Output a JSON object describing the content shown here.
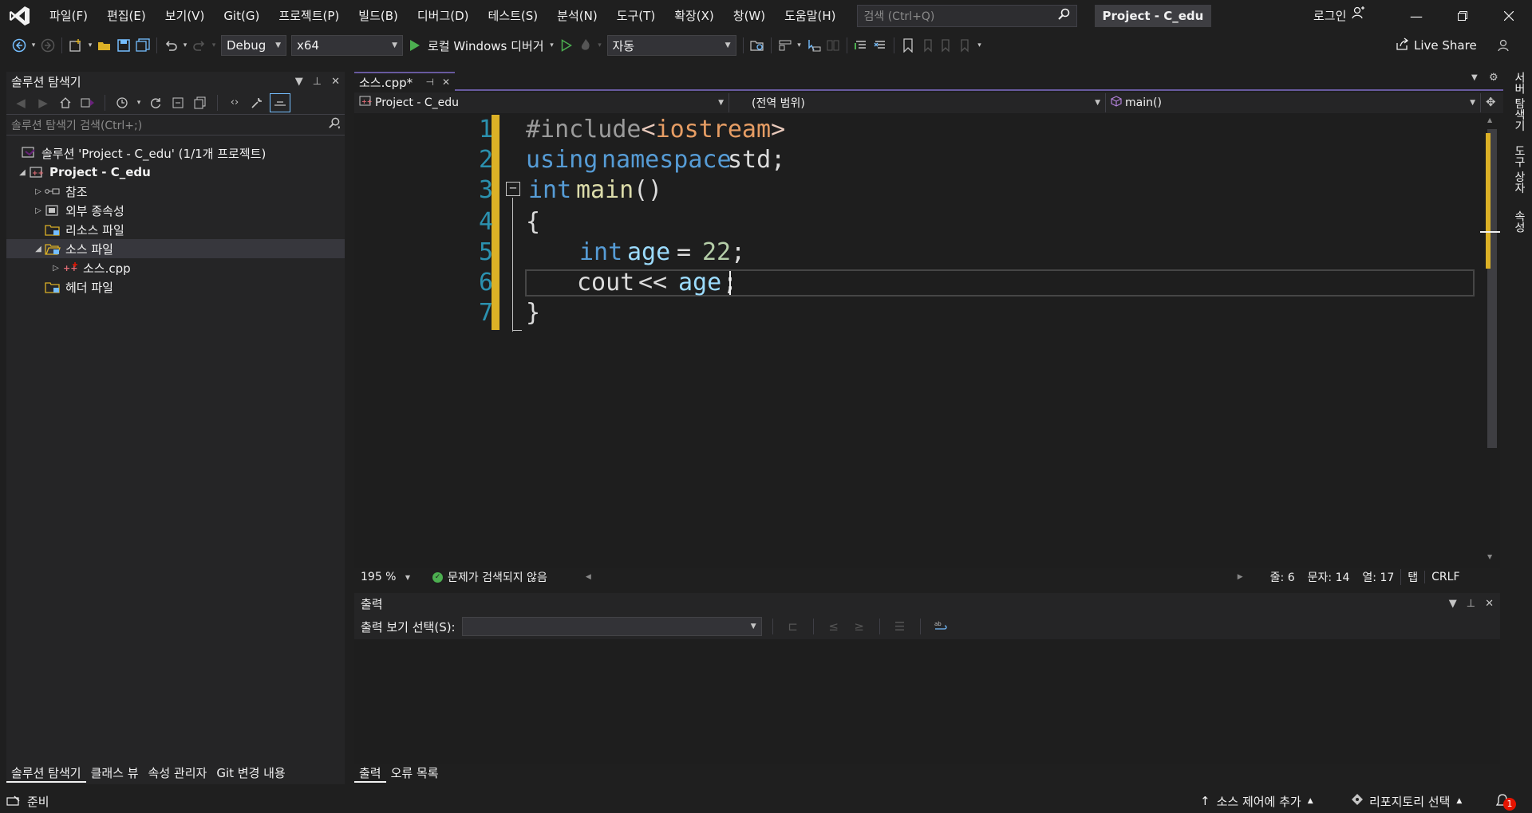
{
  "menu": [
    "파일(F)",
    "편집(E)",
    "보기(V)",
    "Git(G)",
    "프로젝트(P)",
    "빌드(B)",
    "디버그(D)",
    "테스트(S)",
    "분석(N)",
    "도구(T)",
    "확장(X)",
    "창(W)",
    "도움말(H)"
  ],
  "search": {
    "placeholder": "검색 (Ctrl+Q)"
  },
  "title_badge": "Project - C_edu",
  "login": "로그인",
  "toolbar": {
    "config": "Debug",
    "platform": "x64",
    "run_label": "로컬 Windows 디버거",
    "auto": "자동",
    "live_share": "Live Share"
  },
  "solution_explorer": {
    "title": "솔루션 탐색기",
    "search_placeholder": "솔루션 탐색기 검색(Ctrl+;)",
    "tree": [
      {
        "label": "솔루션 'Project - C_edu' (1/1개 프로젝트)",
        "icon": "solution-icon",
        "expander": ""
      },
      {
        "label": "Project - C_edu",
        "icon": "cpp-project-icon",
        "expander": "◢"
      },
      {
        "label": "참조",
        "icon": "references-icon",
        "expander": "▷"
      },
      {
        "label": "외부 종속성",
        "icon": "external-deps-icon",
        "expander": "▷"
      },
      {
        "label": "리소스 파일",
        "icon": "folder-icon",
        "expander": ""
      },
      {
        "label": "소스 파일",
        "icon": "folder-open-icon",
        "expander": "◢"
      },
      {
        "label": "소스.cpp",
        "icon": "cpp-file-icon",
        "expander": "▷"
      },
      {
        "label": "헤더 파일",
        "icon": "folder-icon",
        "expander": ""
      }
    ],
    "bottom_tabs": [
      "솔루션 탐색기",
      "클래스 뷰",
      "속성 관리자",
      "Git 변경 내용"
    ]
  },
  "editor": {
    "tab_title": "소스.cpp*",
    "nav_project": "Project - C_edu",
    "nav_scope": "(전역 범위)",
    "nav_member": "main()",
    "line_numbers": [
      "1",
      "2",
      "3",
      "4",
      "5",
      "6",
      "7"
    ],
    "code": {
      "l1_directive": "#include",
      "l1_lt": "<",
      "l1_file": "iostream",
      "l1_gt": ">",
      "l2_using": "using",
      "l2_ns": "namespace",
      "l2_std": "std;",
      "l3_int": "int",
      "l3_main": "main",
      "l3_parens": "()",
      "l4_brace": "{",
      "l5_int": "int",
      "l5_age": "age",
      "l5_eq": "=",
      "l5_num": "22",
      "l5_semi": ";",
      "l6_cout": "cout",
      "l6_op": "<<",
      "l6_age": "age",
      "l6_semi": ";",
      "l7_brace": "}"
    },
    "fold_symbol": "−"
  },
  "editor_status": {
    "zoom": "195 %",
    "issues": "문제가 검색되지 않음",
    "line": "줄: 6",
    "char": "문자: 14",
    "col": "열: 17",
    "tabs": "탭",
    "eol": "CRLF"
  },
  "output": {
    "title": "출력",
    "select_label": "출력 보기 선택(S):",
    "tabs": [
      "출력",
      "오류 목록"
    ]
  },
  "right_rail": [
    "서버 탐색기",
    "도구 상자",
    "속성"
  ],
  "statusbar": {
    "ready": "준비",
    "source_control": "소스 제어에 추가",
    "repo": "리포지토리 선택",
    "notifications": "1"
  },
  "colors": {
    "accent": "#685a9f",
    "change_bar": "#dcb126",
    "line_number": "#2b91af",
    "keyword": "#569cd6",
    "identifier": "#9cdcfe"
  }
}
